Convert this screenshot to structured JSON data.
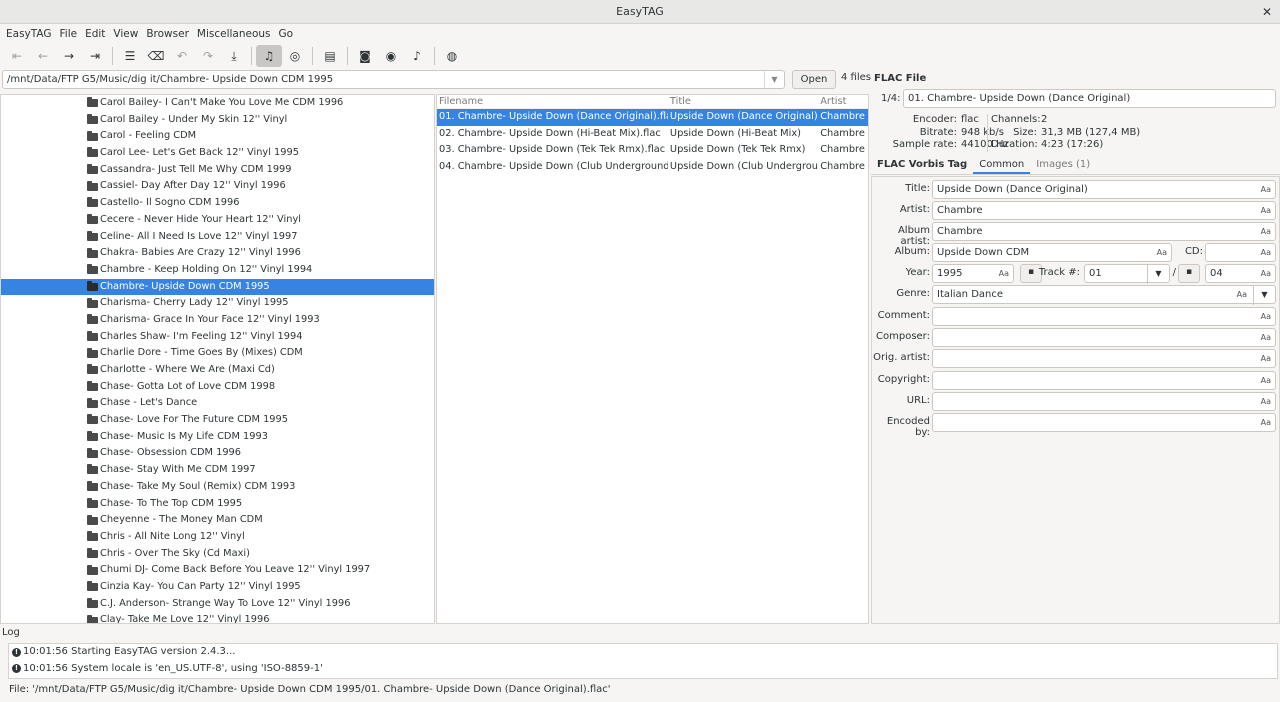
{
  "window": {
    "title": "EasyTAG",
    "close": "✕"
  },
  "menu": [
    "EasyTAG",
    "File",
    "Edit",
    "View",
    "Browser",
    "Miscellaneous",
    "Go"
  ],
  "path": {
    "value": "/mnt/Data/FTP G5/Music/dig it/Chambre- Upside Down CDM 1995",
    "open": "Open",
    "count": "4 files"
  },
  "tree": [
    "Carol Bailey- I Can't Make You Love Me CDM 1996",
    "Carol Bailey - Under My Skin 12'' Vinyl",
    "Carol - Feeling CDM",
    "Carol Lee- Let's Get Back 12'' Vinyl 1995",
    "Cassandra- Just Tell Me Why CDM 1999",
    "Cassiel- Day After Day 12'' Vinyl 1996",
    "Castello- Il Sogno CDM 1996",
    "Cecere - Never Hide Your Heart  12'' Vinyl",
    "Celine- All I Need Is Love 12'' Vinyl 1997",
    "Chakra- Babies Are Crazy 12'' Vinyl 1996",
    "Chambre - Keep Holding On 12'' Vinyl 1994",
    "Chambre- Upside Down CDM 1995",
    "Charisma- Cherry Lady 12'' Vinyl 1995",
    "Charisma- Grace In Your Face 12'' Vinyl 1993",
    "Charles Shaw- I'm Feeling 12'' Vinyl 1994",
    "Charlie Dore - Time Goes By (Mixes) CDM",
    "Charlotte - Where We Are (Maxi Cd)",
    "Chase- Gotta Lot of Love CDM 1998",
    "Chase - Let's Dance",
    "Chase- Love For The Future CDM 1995",
    "Chase- Music Is My Life CDM 1993",
    "Chase- Obsession CDM 1996",
    "Chase- Stay With Me CDM 1997",
    "Chase- Take My Soul  (Remix) CDM 1993",
    "Chase- To The Top CDM 1995",
    "Cheyenne - The Money Man CDM",
    "Chris - All Nite Long 12'' Vinyl",
    "Chris - Over The Sky (Cd Maxi)",
    "Chumi DJ- Come Back Before You Leave 12'' Vinyl 1997",
    "Cinzia Kay- You Can Party 12'' Vinyl 1995",
    "C.J. Anderson- Strange Way To Love 12'' Vinyl 1996",
    "Clay- Take Me Love 12'' Vinyl 1996"
  ],
  "tree_selected": 11,
  "files": {
    "headers": [
      "Filename",
      "Title",
      "Artist"
    ],
    "rows": [
      [
        "01. Chambre- Upside Down (Dance Original).flac",
        "Upside Down (Dance Original)",
        "Chambre"
      ],
      [
        "02. Chambre- Upside Down (Hi-Beat Mix).flac",
        "Upside Down (Hi-Beat Mix)",
        "Chambre"
      ],
      [
        "03. Chambre- Upside Down (Tek Tek Rmx).flac",
        "Upside Down (Tek Tek Rmx)",
        "Chambre"
      ],
      [
        "04. Chambre- Upside Down (Club Underground).flac",
        "Upside Down (Club Underground)",
        "Chambre"
      ]
    ],
    "selected": 0
  },
  "fileinfo": {
    "heading": "FLAC File",
    "index": "1/4:",
    "filename": "01. Chambre- Upside Down (Dance Original)",
    "labels1": [
      "Encoder:",
      "Bitrate:",
      "Sample rate:"
    ],
    "values1": [
      "flac",
      "948 kb/s",
      "44100 Hz"
    ],
    "labels2": [
      "Channels:",
      "Size:",
      "Duration:"
    ],
    "values2": [
      "2",
      "31,3 MB (127,4 MB)",
      "4:23 (17:26)"
    ]
  },
  "tabs": [
    "FLAC Vorbis Tag",
    "Common",
    "Images (1)"
  ],
  "tag": {
    "title_l": "Title:",
    "title": "Upside Down (Dance Original)",
    "artist_l": "Artist:",
    "artist": "Chambre",
    "albumartist_l": "Album artist:",
    "albumartist": "Chambre",
    "album_l": "Album:",
    "album": "Upside Down CDM",
    "cd_l": "CD:",
    "cd": "",
    "year_l": "Year:",
    "year": "1995",
    "track_l": "Track #:",
    "track": "01",
    "slash": "/",
    "total": "04",
    "genre_l": "Genre:",
    "genre": "Italian Dance",
    "comment_l": "Comment:",
    "composer_l": "Composer:",
    "origartist_l": "Orig. artist:",
    "copyright_l": "Copyright:",
    "url_l": "URL:",
    "encodedby_l": "Encoded by:",
    "case_icon": "Aa"
  },
  "log": {
    "heading": "Log",
    "lines": [
      "10:01:56 Starting EasyTAG version 2.4.3...",
      "10:01:56 System locale is 'en_US.UTF-8', using 'ISO-8859-1'"
    ]
  },
  "status": "File: '/mnt/Data/FTP G5/Music/dig it/Chambre- Upside Down CDM 1995/01. Chambre- Upside Down (Dance Original).flac'"
}
